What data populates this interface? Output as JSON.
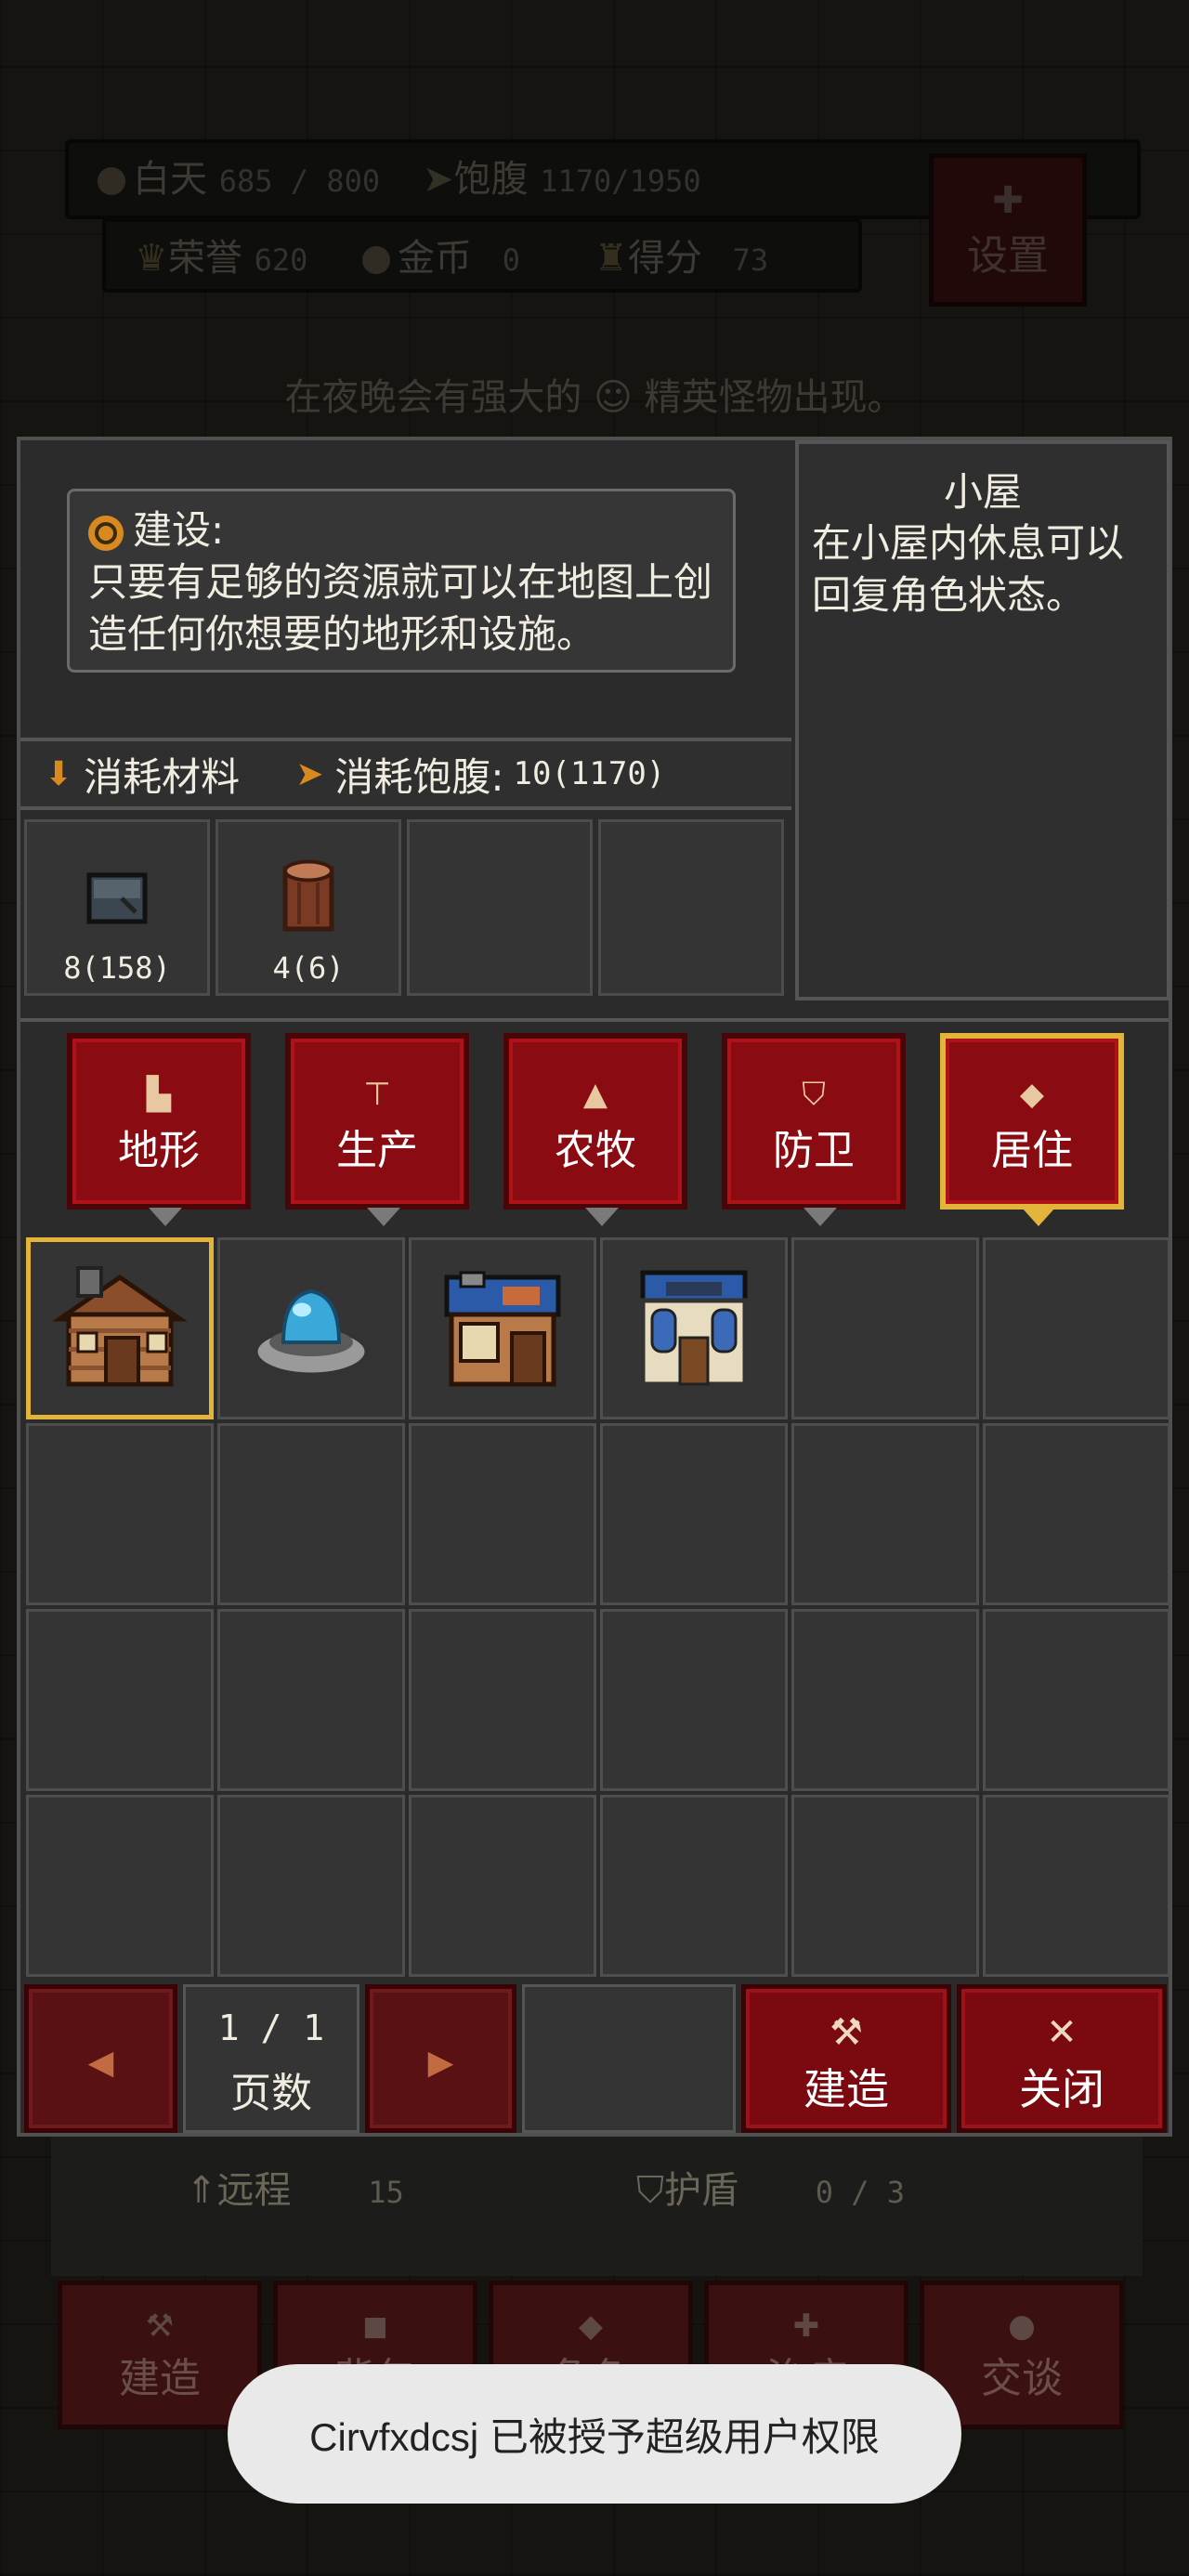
{
  "hud": {
    "day_label": "白天",
    "day_value": "685 / 800",
    "hunger_label": "饱腹",
    "hunger_value": "1170/1950",
    "honor_label": "荣誉",
    "honor_value": "620",
    "gold_label": "金币",
    "gold_value": "0",
    "score_label": "得分",
    "score_value": "73",
    "settings_label": "设置"
  },
  "night_message": "在夜晚会有强大的 ☺ 精英怪物出现。",
  "build_tip": {
    "title": "建设:",
    "text": "只要有足够的资源就可以在地图上创造任何你想要的地形和设施。"
  },
  "description": {
    "title": "小屋",
    "text": "在小屋内休息可以回复角色状态。"
  },
  "cost": {
    "materials_label": "消耗材料",
    "hunger_label": "消耗饱腹:",
    "hunger_value": "10(1170)"
  },
  "materials": [
    {
      "name": "stone-icon",
      "count": "8(158)"
    },
    {
      "name": "wood-log-icon",
      "count": "4(6)"
    }
  ],
  "categories": [
    {
      "label": "地形",
      "icon": "terrain-icon"
    },
    {
      "label": "生产",
      "icon": "anvil-icon"
    },
    {
      "label": "农牧",
      "icon": "tree-icon"
    },
    {
      "label": "防卫",
      "icon": "shield-icon"
    },
    {
      "label": "居住",
      "icon": "diamond-icon",
      "selected": true
    }
  ],
  "buildings": [
    {
      "name": "cabin-icon",
      "selected": true
    },
    {
      "name": "fountain-icon"
    },
    {
      "name": "blue-house-icon"
    },
    {
      "name": "chapel-icon"
    }
  ],
  "pager": {
    "page": "1 / 1",
    "label": "页数"
  },
  "actions": {
    "build_label": "建造",
    "close_label": "关闭"
  },
  "background_stats": {
    "ranged_label": "远程",
    "ranged_value": "15",
    "shield_label": "护盾",
    "shield_value": "0 / 3"
  },
  "background_buttons": [
    "建造",
    "背包",
    "角色",
    "治疗",
    "交谈"
  ],
  "toast": "Cirvfxdcsj 已被授予超级用户权限",
  "colors": {
    "accent_red": "#8a0c12",
    "selected_gold": "#e2b43a",
    "panel_gray": "#2b2b2b"
  }
}
